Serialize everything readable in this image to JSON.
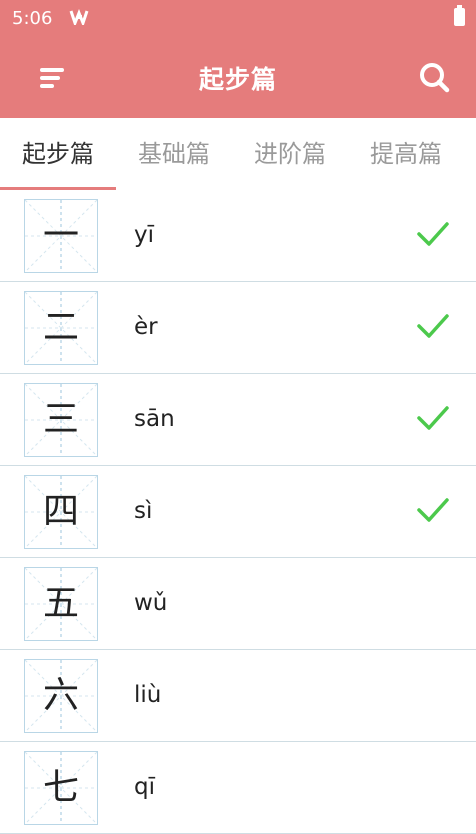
{
  "status_bar": {
    "time": "5:06",
    "notification_icon": "app-notification-icon",
    "battery_icon": "battery-icon"
  },
  "toolbar": {
    "title": "起步篇",
    "menu_icon": "menu-icon",
    "search_icon": "search-icon"
  },
  "colors": {
    "primary": "#e57c7c",
    "check": "#4cc94c",
    "grid_line": "#b9d6e6",
    "divider": "#cfdde3"
  },
  "tabs": [
    {
      "label": "起步篇",
      "active": true
    },
    {
      "label": "基础篇",
      "active": false
    },
    {
      "label": "进阶篇",
      "active": false
    },
    {
      "label": "提高篇",
      "active": false
    }
  ],
  "characters": [
    {
      "char": "一",
      "pinyin": "yī",
      "learned": true
    },
    {
      "char": "二",
      "pinyin": "èr",
      "learned": true
    },
    {
      "char": "三",
      "pinyin": "sān",
      "learned": true
    },
    {
      "char": "四",
      "pinyin": "sì",
      "learned": true
    },
    {
      "char": "五",
      "pinyin": "wǔ",
      "learned": false
    },
    {
      "char": "六",
      "pinyin": "liù",
      "learned": false
    },
    {
      "char": "七",
      "pinyin": "qī",
      "learned": false
    }
  ]
}
